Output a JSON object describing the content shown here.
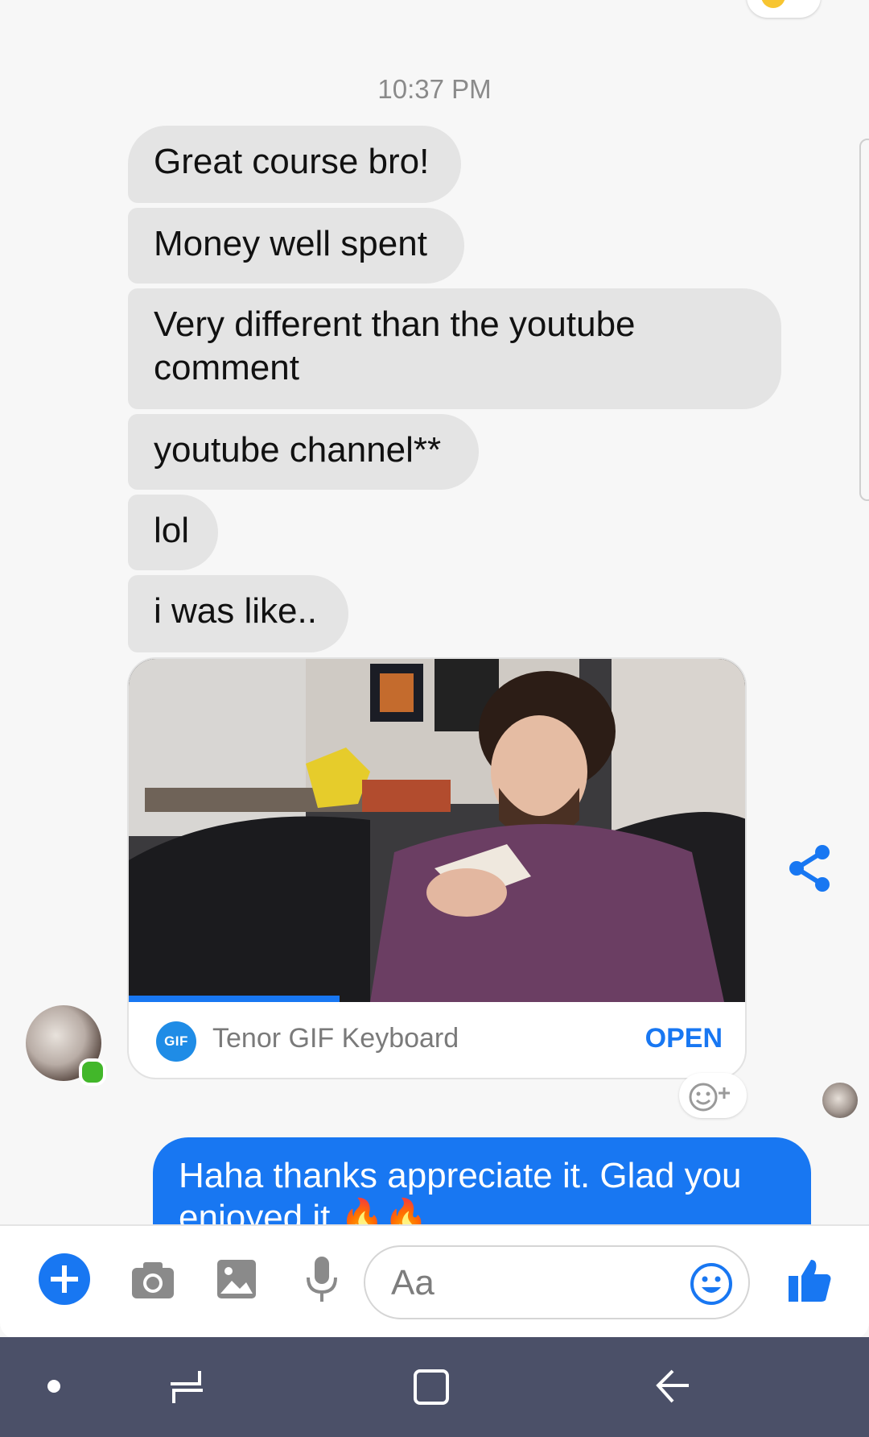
{
  "timestamp": "10:37 PM",
  "messages": [
    {
      "text": "Great course bro!"
    },
    {
      "text": "Money well spent"
    },
    {
      "text": "Very different than the youtube comment"
    },
    {
      "text": "youtube channel**"
    },
    {
      "text": "lol"
    },
    {
      "text": "i was like.."
    }
  ],
  "gif": {
    "source_label": "Tenor GIF Keyboard",
    "logo_text": "GIF",
    "open_label": "OPEN",
    "progress": 0.34
  },
  "reply": {
    "text": "Haha thanks appreciate it. Glad you enjoyed it 🔥🔥"
  },
  "composer": {
    "placeholder": "Aa"
  },
  "icons": {
    "plus": "plus-icon",
    "camera": "camera-icon",
    "gallery": "image-icon",
    "mic": "microphone-icon",
    "emoji": "emoji-icon",
    "like": "thumbs-up-icon",
    "share": "share-icon",
    "add_reaction": "add-reaction-icon"
  },
  "colors": {
    "accent": "#1877f2",
    "incoming_bubble": "#e4e4e4",
    "online": "#42b72a",
    "navbar": "#4b5068"
  }
}
